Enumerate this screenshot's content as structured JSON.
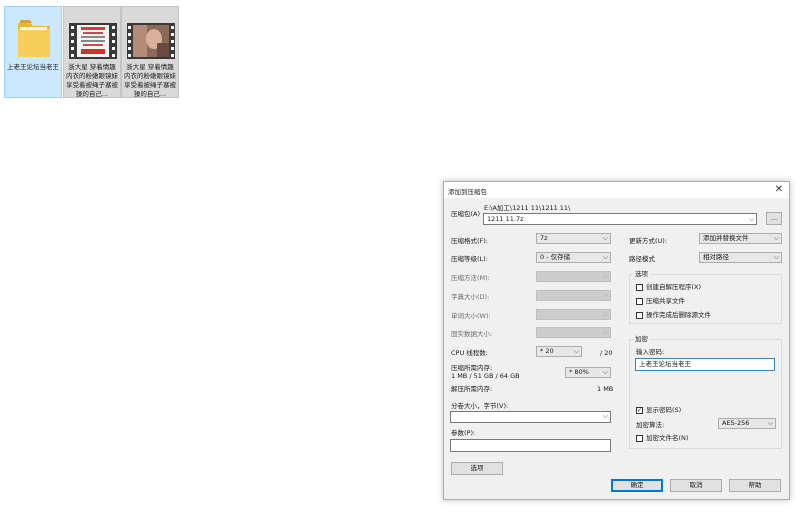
{
  "desktop": {
    "files": [
      {
        "label": "上老王论坛当老王",
        "icon": "folder-icon"
      },
      {
        "label": "浙大星 穿着情趣内衣的粉嫩眼镜妹 享受着被绳子塞被操的自己...",
        "icon": "video-thumbnail"
      },
      {
        "label": "浙大星 穿着情趣内衣的粉嫩眼镜妹 享受着被绳子塞被操的自己...",
        "icon": "video-thumbnail"
      }
    ]
  },
  "dialog": {
    "title": "添加到压缩包",
    "close": "✕",
    "archive": {
      "label": "压缩包(A)",
      "path": "E:\\A加工\\1211 11\\1211 11\\",
      "name": "1211 11.7z",
      "browse": "..."
    },
    "left": {
      "format": {
        "label": "压缩格式(F):",
        "value": "7z"
      },
      "level": {
        "label": "压缩等级(L):",
        "value": "0 - 仅存储"
      },
      "method": {
        "label": "压缩方法(M):",
        "value": ""
      },
      "dict": {
        "label": "字典大小(D):",
        "value": ""
      },
      "word": {
        "label": "单词大小(W):",
        "value": ""
      },
      "solid": {
        "label": "固实数据大小:",
        "value": ""
      },
      "cpu": {
        "label": "CPU 线程数:",
        "value": "* 20",
        "max": "/ 20"
      },
      "mem": {
        "label": "压缩所需内存:",
        "detail": "1 MB / 51 GB / 64 GB",
        "value": "* 80%"
      },
      "demem": {
        "label": "解压所需内存:",
        "value": "1 MB"
      },
      "split": {
        "label": "分卷大小，字节(V):",
        "value": ""
      },
      "params": {
        "label": "参数(P):",
        "value": ""
      },
      "options_button": "选项"
    },
    "right": {
      "update": {
        "label": "更新方式(U):",
        "value": "添加并替换文件"
      },
      "pathmode": {
        "label": "路径模式",
        "value": "相对路径"
      },
      "options": {
        "title": "选项",
        "sfx": {
          "label": "创建自解压程序(X)",
          "checked": false
        },
        "shared": {
          "label": "压缩共享文件",
          "checked": false
        },
        "delete": {
          "label": "操作完成后删除源文件",
          "checked": false
        }
      },
      "encryption": {
        "title": "加密",
        "pw_label": "输入密码:",
        "password": "上老王论坛当老王",
        "show_pw": {
          "label": "显示密码(S)",
          "checked": true
        },
        "method_label": "加密算法:",
        "method": "AES-256",
        "encrypt_names": {
          "label": "加密文件名(N)",
          "checked": false
        }
      }
    },
    "buttons": {
      "ok": "确定",
      "cancel": "取消",
      "help": "帮助"
    }
  }
}
